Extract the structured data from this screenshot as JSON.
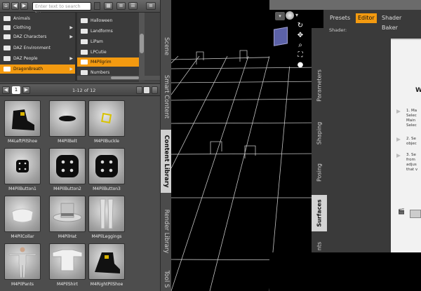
{
  "left_panel": {
    "search_placeholder": "Enter text to search by...",
    "folders_left": [
      {
        "label": "Animals",
        "arrow": "",
        "selected": false
      },
      {
        "label": "Clothing",
        "arrow": "▶",
        "selected": false
      },
      {
        "label": "DAZ Characters",
        "arrow": "▶",
        "selected": false
      },
      {
        "label": "DAZ Environment",
        "arrow": "",
        "selected": false
      },
      {
        "label": "DAZ People",
        "arrow": "▶",
        "selected": false
      },
      {
        "label": "DragonBreath",
        "arrow": "▶",
        "selected": true
      }
    ],
    "folders_right": [
      {
        "label": "Halloween",
        "selected": false
      },
      {
        "label": "Landforms",
        "selected": false
      },
      {
        "label": "LiPam",
        "selected": false
      },
      {
        "label": "LPCutie",
        "selected": false
      },
      {
        "label": "M4Pilgrim",
        "selected": true
      },
      {
        "label": "Numbers",
        "selected": false
      }
    ],
    "page_number": "1",
    "result_count": "1-12 of 12",
    "items": [
      {
        "label": "M4LeftPilShoe",
        "icon": "shoe-icon"
      },
      {
        "label": "M4PilBelt",
        "icon": "belt-icon"
      },
      {
        "label": "M4PilBuckle",
        "icon": "buckle-icon"
      },
      {
        "label": "M4PilButton1",
        "icon": "button-icon"
      },
      {
        "label": "M4PilButton2",
        "icon": "button-icon"
      },
      {
        "label": "M4PilButton3",
        "icon": "button-icon"
      },
      {
        "label": "M4PilCollar",
        "icon": "collar-icon"
      },
      {
        "label": "M4PilHat",
        "icon": "hat-icon"
      },
      {
        "label": "M4PilLeggings",
        "icon": "leggings-icon"
      },
      {
        "label": "M4PilPants",
        "icon": "figure-icon"
      },
      {
        "label": "M4PilShirt",
        "icon": "shirt-icon"
      },
      {
        "label": "M4RightPilShoe",
        "icon": "shoe-icon"
      }
    ]
  },
  "side_tabs": [
    "Scene",
    "Smart Content",
    "Content Library",
    "Render Library",
    "Tool S"
  ],
  "active_side_tab": "Content Library",
  "right_panel": {
    "tabs": [
      "Presets",
      "Editor",
      "Shader Baker"
    ],
    "active_tab": "Editor",
    "shader_label": "Shader:",
    "vertical_tabs": [
      "Parameters",
      "Shaping",
      "Posing",
      "Surfaces",
      "nts"
    ],
    "active_vertical_tab": "Surfaces",
    "editor_heading": "W",
    "steps": [
      {
        "lines": [
          "1. Ma",
          "Selec",
          "Main",
          "Selec"
        ]
      },
      {
        "lines": [
          "2. Se",
          "objec"
        ]
      },
      {
        "lines": [
          "3. Se",
          "from",
          "adjus",
          "that v"
        ]
      }
    ]
  },
  "colors": {
    "accent": "#f39a10",
    "viewport_bg": "#000000",
    "grid_line": "#bdbdbd"
  }
}
